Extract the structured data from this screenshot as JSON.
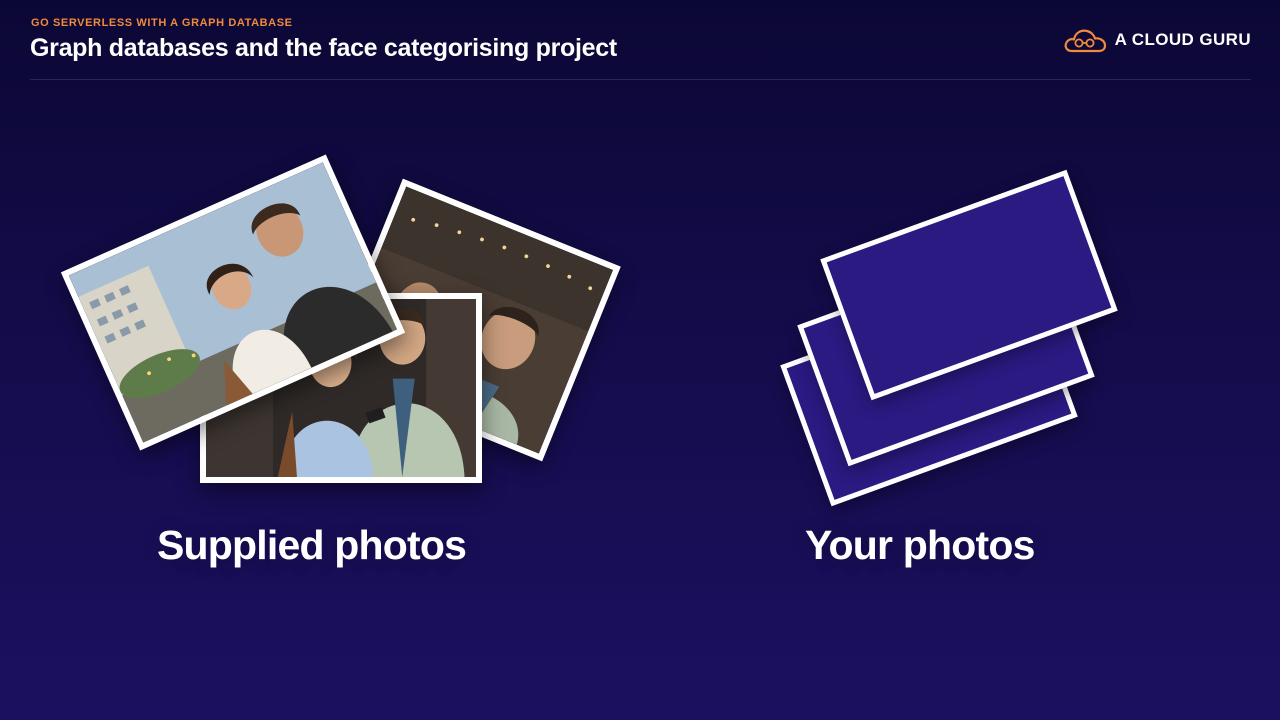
{
  "header": {
    "kicker": "GO SERVERLESS WITH A GRAPH DATABASE",
    "title": "Graph databases and the face categorising project"
  },
  "brand": {
    "name": "A CLOUD GURU",
    "logo_icon": "cloud-logo-icon",
    "accent": "#f08a3c"
  },
  "left_panel": {
    "caption": "Supplied photos"
  },
  "right_panel": {
    "caption": "Your photos",
    "card_color": "#2a1a82"
  },
  "colors": {
    "background_top": "#0b0735",
    "background_bottom": "#1b1060",
    "text": "#ffffff"
  }
}
